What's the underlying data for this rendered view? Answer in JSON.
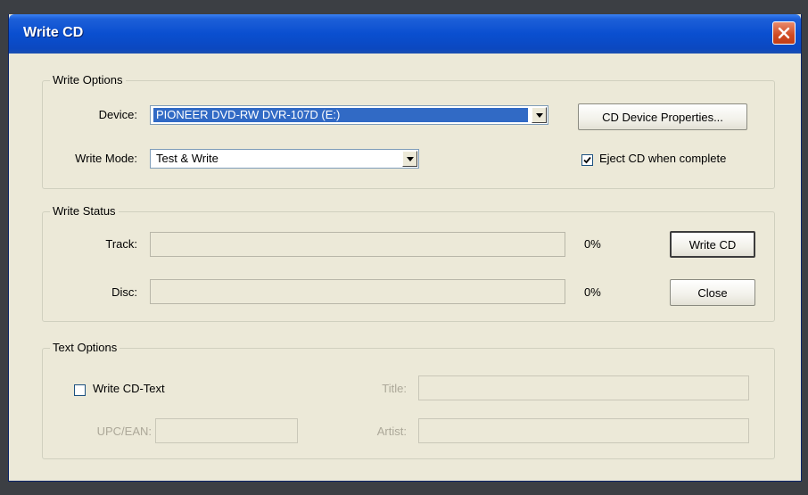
{
  "window": {
    "title": "Write CD"
  },
  "write_options": {
    "label": "Write Options",
    "device_label": "Device:",
    "device_value": "PIONEER DVD-RW  DVR-107D (E:)",
    "write_mode_label": "Write Mode:",
    "write_mode_value": "Test & Write",
    "properties_button": "CD Device Properties...",
    "eject_label": "Eject CD when complete",
    "eject_checked": true
  },
  "write_status": {
    "label": "Write Status",
    "track_label": "Track:",
    "track_percent": "0%",
    "track_progress": 0,
    "disc_label": "Disc:",
    "disc_percent": "0%",
    "disc_progress": 0,
    "write_button": "Write CD",
    "close_button": "Close"
  },
  "text_options": {
    "label": "Text Options",
    "write_cd_text_label": "Write CD-Text",
    "write_cd_text_checked": false,
    "title_label": "Title:",
    "title_value": "",
    "upc_label": "UPC/EAN:",
    "upc_value": "",
    "artist_label": "Artist:",
    "artist_value": ""
  },
  "icons": {
    "close": "close-icon",
    "dropdown": "chevron-down-icon",
    "check": "checkmark-icon"
  },
  "colors": {
    "titlebar": "#0a4fd0",
    "dialog_bg": "#ece9d8",
    "selection": "#316ac5",
    "close_button": "#d04a22"
  }
}
